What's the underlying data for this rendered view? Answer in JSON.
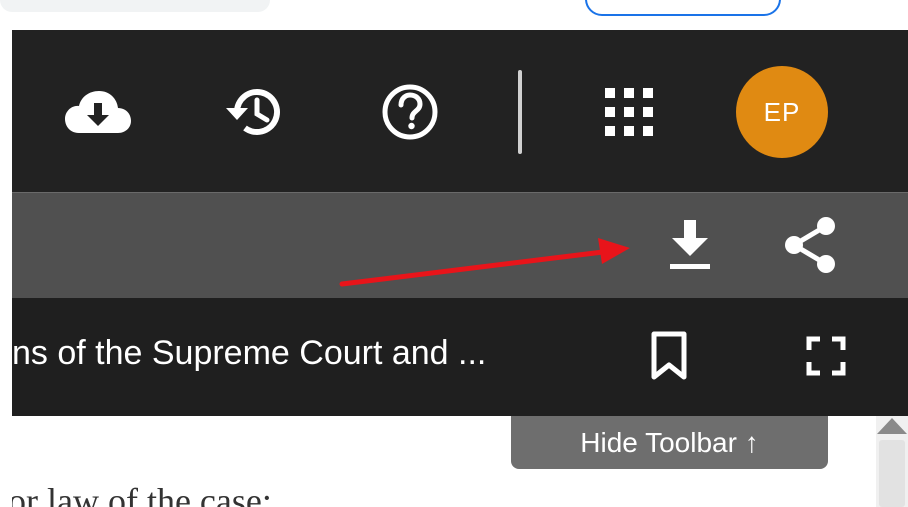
{
  "header": {
    "icons": [
      {
        "name": "cloud-download-icon"
      },
      {
        "name": "history-icon"
      },
      {
        "name": "help-icon"
      },
      {
        "name": "apps-grid-icon"
      }
    ],
    "avatar_initials": "EP",
    "avatar_color": "#e08a12"
  },
  "doc_toolbar": {
    "icons": [
      "download-icon",
      "share-icon"
    ]
  },
  "title_bar": {
    "title": "ns of the Supreme Court and ...",
    "icons": [
      "bookmark-icon",
      "fullscreen-icon"
    ]
  },
  "content": {
    "text": "or law of the case:"
  },
  "hide_toolbar": {
    "label": "Hide Toolbar ↑"
  },
  "annotation": {
    "arrow_color": "#e8141a"
  }
}
